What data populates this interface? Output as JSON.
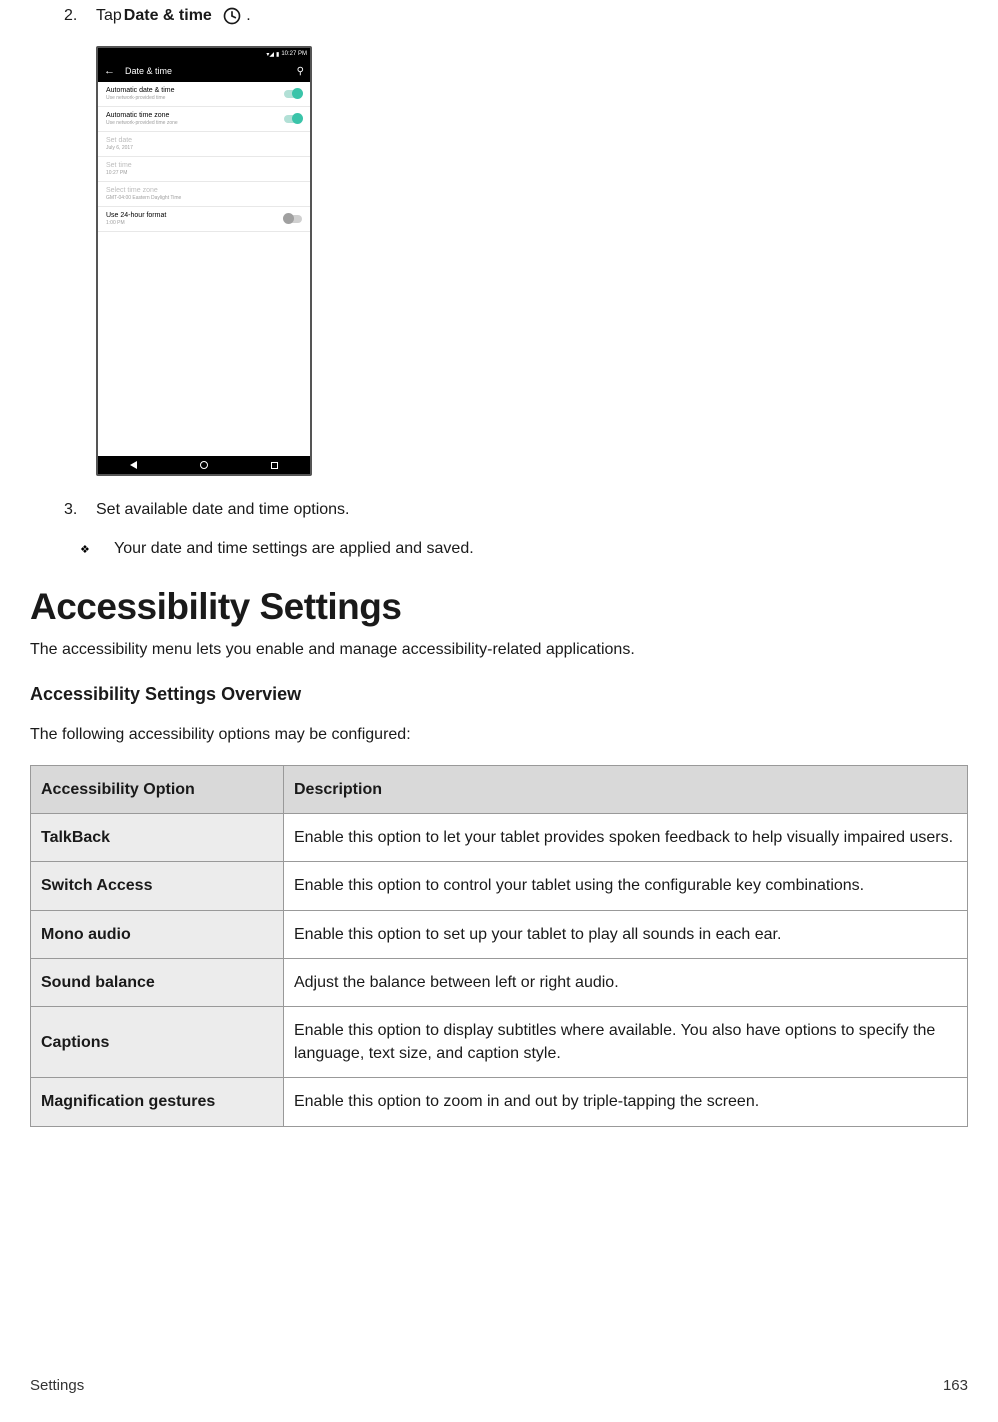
{
  "step2": {
    "num": "2.",
    "prefix": "Tap ",
    "bold": "Date & time",
    "suffix": "."
  },
  "phone": {
    "status_time": "10:27 PM",
    "header_title": "Date & time",
    "rows": [
      {
        "title": "Automatic date & time",
        "sub": "Use network-provided time",
        "toggle": "on"
      },
      {
        "title": "Automatic time zone",
        "sub": "Use network-provided time zone",
        "toggle": "on"
      },
      {
        "title": "Set date",
        "sub": "July 6, 2017",
        "disabled": true
      },
      {
        "title": "Set time",
        "sub": "10:27 PM",
        "disabled": true
      },
      {
        "title": "Select time zone",
        "sub": "GMT-04:00 Eastern Daylight Time",
        "disabled": true
      },
      {
        "title": "Use 24-hour format",
        "sub": "1:00 PM",
        "toggle": "off"
      }
    ]
  },
  "step3": {
    "num": "3.",
    "text": "Set available date and time options."
  },
  "note": "Your date and time settings are applied and saved.",
  "heading": "Accessibility Settings",
  "intro": "The accessibility menu lets you enable and manage accessibility-related applications.",
  "subheading": "Accessibility Settings Overview",
  "lead": "The following accessibility options may be configured:",
  "table": {
    "h1": "Accessibility Option",
    "h2": "Description",
    "rows": [
      {
        "opt": "TalkBack",
        "desc": "Enable this option to let your tablet provides spoken feedback to help visually impaired users."
      },
      {
        "opt": "Switch Access",
        "desc": "Enable this option to control your tablet using the configurable key combinations."
      },
      {
        "opt": "Mono audio",
        "desc": "Enable this option to set up your tablet to play all sounds in each ear."
      },
      {
        "opt": "Sound balance",
        "desc": "Adjust the balance between left or right audio."
      },
      {
        "opt": "Captions",
        "desc": "Enable this option to display subtitles where available. You also have options to specify the language, text size, and caption style."
      },
      {
        "opt": "Magnification gestures",
        "desc": "Enable this option to zoom in and out by triple-tapping the screen."
      }
    ]
  },
  "footer": {
    "section": "Settings",
    "page": "163"
  }
}
